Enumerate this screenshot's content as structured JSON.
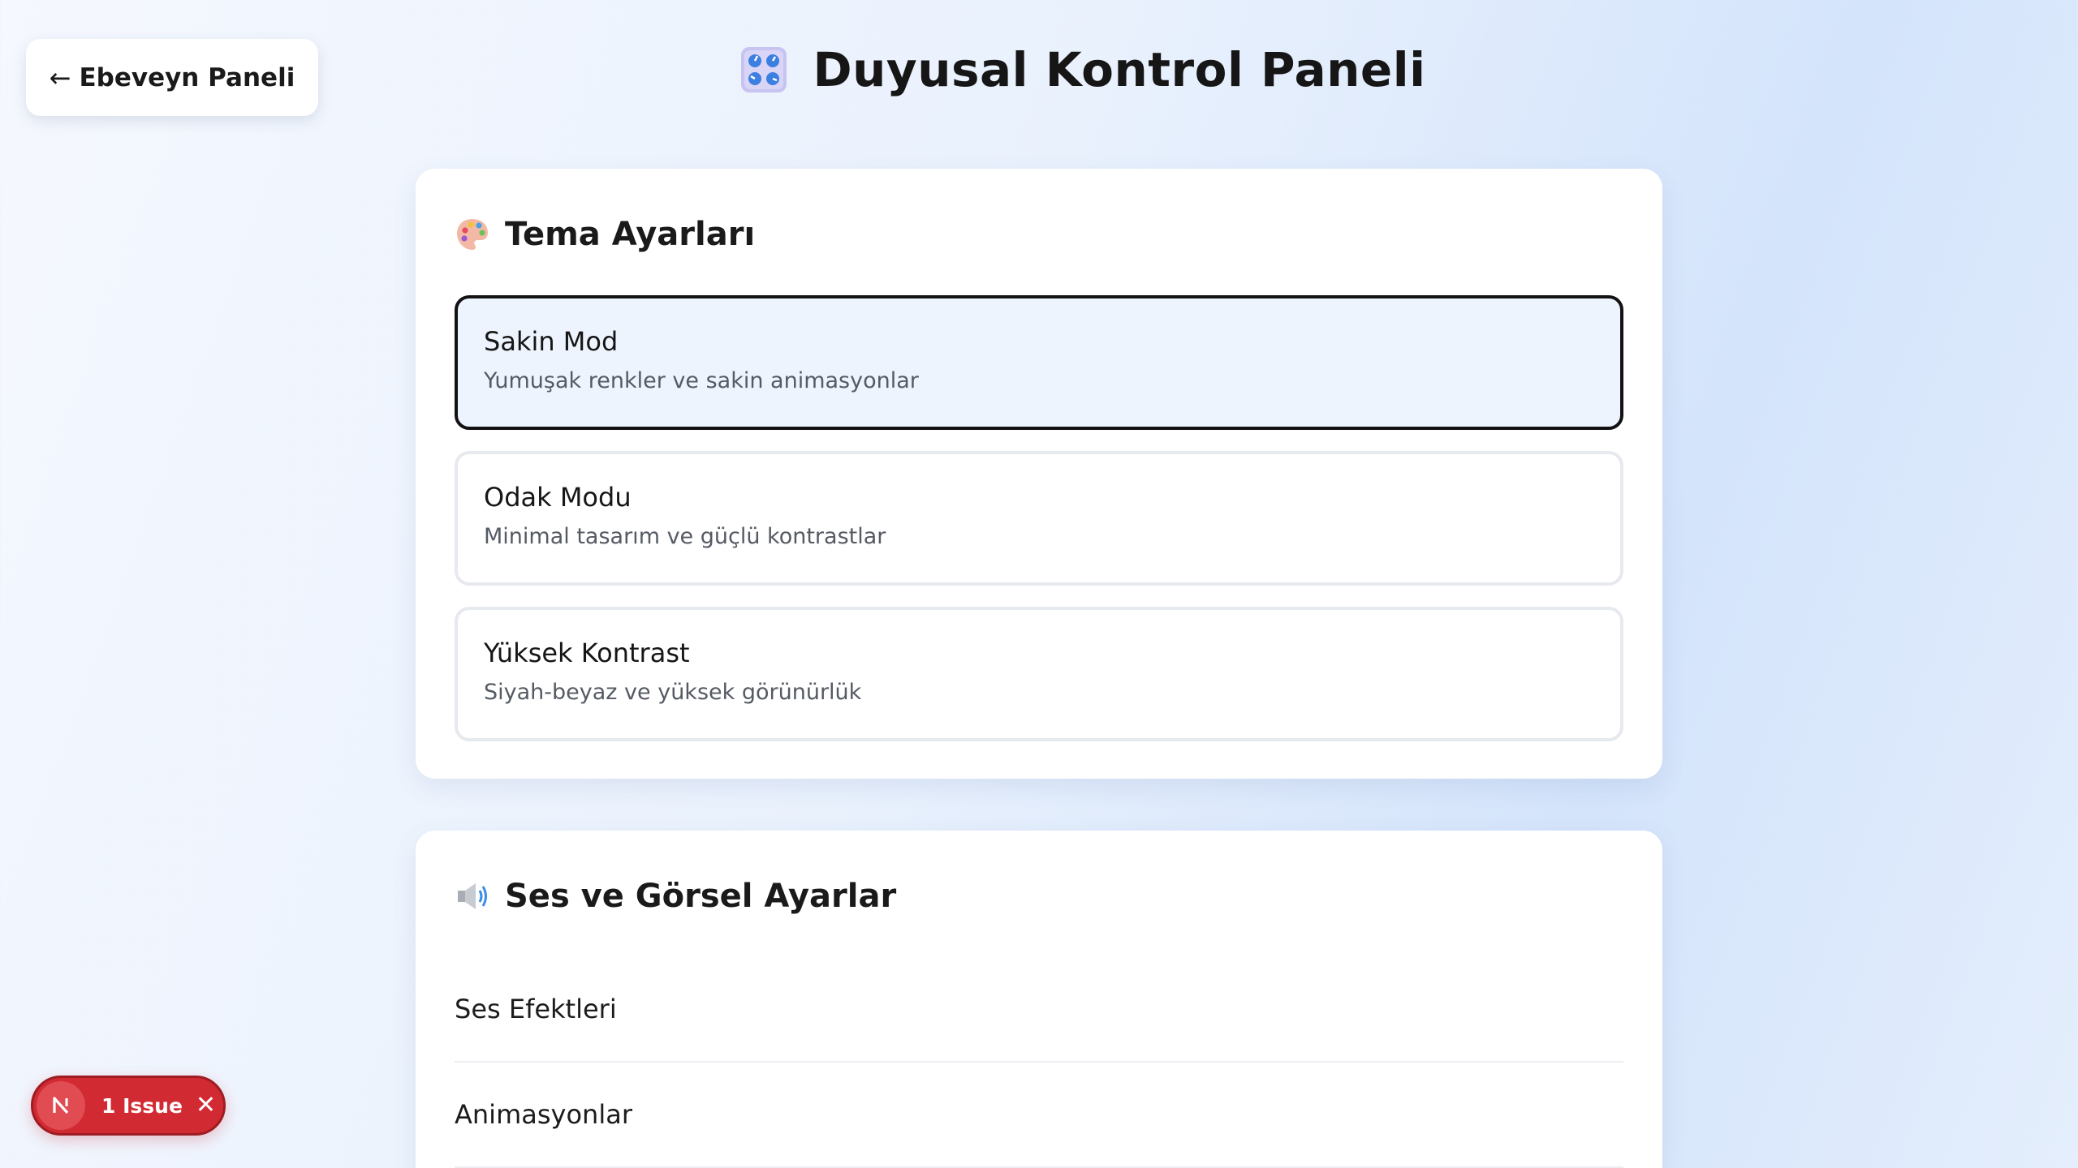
{
  "header": {
    "back_label": "Ebeveyn Paneli",
    "back_arrow": "←",
    "title": "Duyusal Kontrol Paneli",
    "title_icon": "control-knobs-icon"
  },
  "theme_settings": {
    "title": "Tema Ayarları",
    "icon": "palette-icon",
    "options": [
      {
        "title": "Sakin Mod",
        "description": "Yumuşak renkler ve sakin animasyonlar",
        "selected": true
      },
      {
        "title": "Odak Modu",
        "description": "Minimal tasarım ve güçlü kontrastlar",
        "selected": false
      },
      {
        "title": "Yüksek Kontrast",
        "description": "Siyah-beyaz ve yüksek görünürlük",
        "selected": false
      }
    ]
  },
  "sound_visual_settings": {
    "title": "Ses ve Görsel Ayarlar",
    "icon": "speaker-icon",
    "items": [
      {
        "label": "Ses Efektleri"
      },
      {
        "label": "Animasyonlar"
      }
    ]
  },
  "dev_overlay": {
    "issue_label": "1 Issue",
    "logo_letter": "N",
    "close_symbol": "✕",
    "color": "#d22a32"
  },
  "colors": {
    "selected_border": "#121212",
    "selected_background": "#eef4fe",
    "card_background": "#ffffff"
  }
}
